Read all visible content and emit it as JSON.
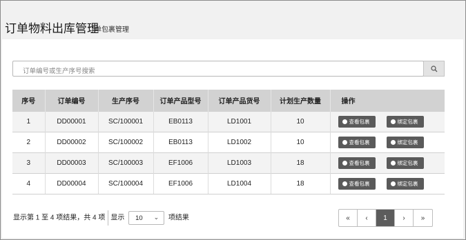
{
  "page": {
    "title": "订单物料出库管理",
    "subtitle": "订单包裹管理"
  },
  "search": {
    "placeholder": "订单编号或生产序号搜索",
    "button_icon": "search-icon"
  },
  "table": {
    "headers": [
      "序号",
      "订单编号",
      "生产序号",
      "订单产品型号",
      "订单产品货号",
      "计划生产数量",
      "操作"
    ],
    "rows": [
      {
        "no": "1",
        "order_no": "DD00001",
        "prod_seq": "SC/100001",
        "model": "EB0113",
        "sku": "LD1001",
        "qty": "10",
        "view": "查看包裹",
        "bind": "绑定包裹"
      },
      {
        "no": "2",
        "order_no": "DD00002",
        "prod_seq": "SC/100002",
        "model": "EB0113",
        "sku": "LD1002",
        "qty": "10",
        "view": "查看包裹",
        "bind": "绑定包裹"
      },
      {
        "no": "3",
        "order_no": "DD00003",
        "prod_seq": "SC/100003",
        "model": "EF1006",
        "sku": "LD1003",
        "qty": "18",
        "view": "查看包裹",
        "bind": "绑定包裹"
      },
      {
        "no": "4",
        "order_no": "DD00004",
        "prod_seq": "SC/100004",
        "model": "EF1006",
        "sku": "LD1004",
        "qty": "18",
        "view": "查看包裹",
        "bind": "绑定包裹"
      }
    ]
  },
  "footer": {
    "info": "显示第 1 至 4 项结果，共 4 项",
    "show_label": "显示",
    "page_size": "10",
    "results_label": "项结果"
  },
  "pagination": {
    "first": "«",
    "prev": "‹",
    "current": "1",
    "next": "›",
    "last": "»"
  }
}
